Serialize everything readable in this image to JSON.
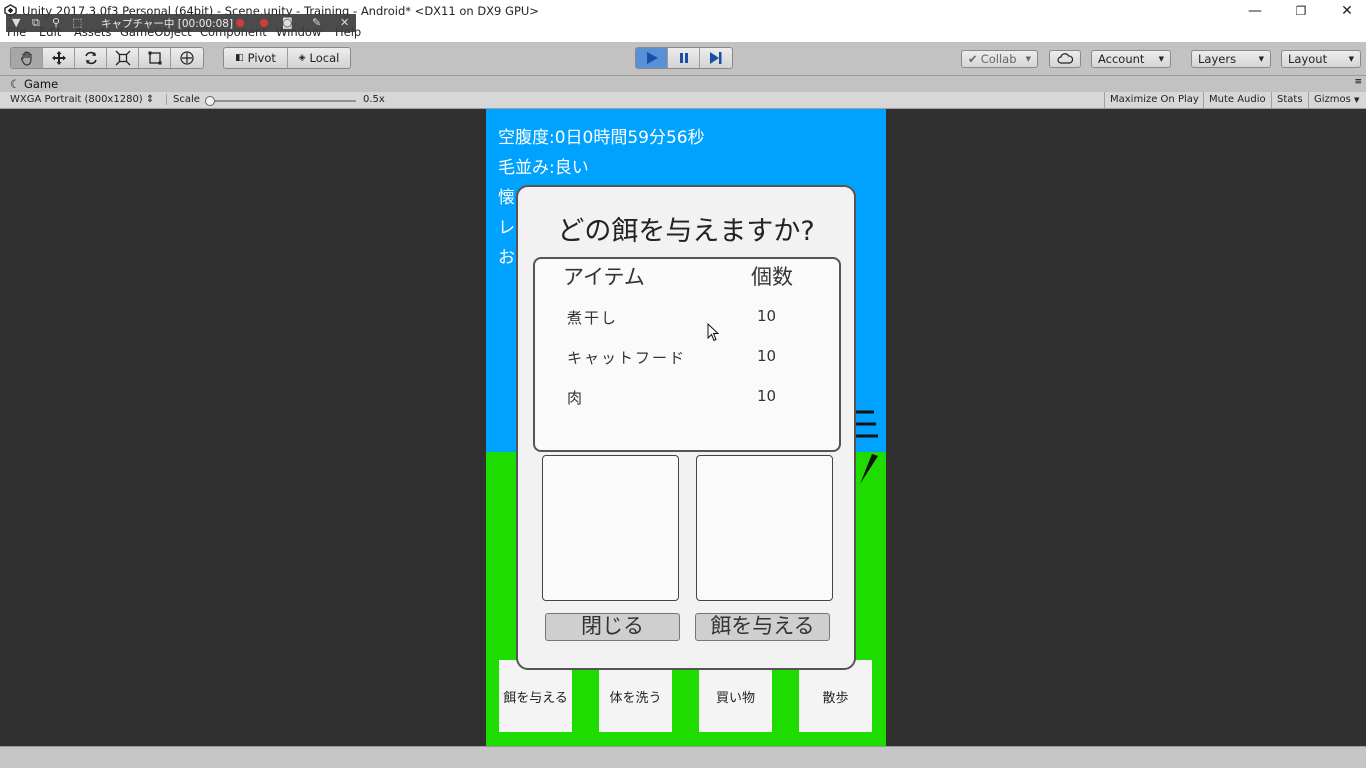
{
  "window": {
    "title": "Unity 2017.3.0f3 Personal (64bit) - Scene.unity - Training - Android* <DX11 on DX9 GPU>",
    "minimize": "—",
    "maximize": "❐",
    "close": "✕"
  },
  "menu": [
    "File",
    "Edit",
    "Assets",
    "GameObject",
    "Component",
    "Window",
    "Help"
  ],
  "capture_overlay": {
    "label": "キャプチャー中 [00:00:08]"
  },
  "toolbar": {
    "pivot": "Pivot",
    "local": "Local",
    "collab": "Collab",
    "account": "Account",
    "layers": "Layers",
    "layout": "Layout"
  },
  "game_tab": {
    "label": "Game",
    "resolution": "WXGA Portrait (800x1280)",
    "scale_label": "Scale",
    "scale_value": "0.5x",
    "maximize_on_play": "Maximize On Play",
    "mute_audio": "Mute Audio",
    "stats": "Stats",
    "gizmos": "Gizmos"
  },
  "game": {
    "status_lines": [
      "空腹度:0日0時間59分56秒",
      "毛並み:良い",
      "懐",
      "レ",
      "お"
    ],
    "dialog": {
      "title": "どの餌を与えますか?",
      "col_item": "アイテム",
      "col_count": "個数",
      "items": [
        {
          "name": "煮干し",
          "count": "10"
        },
        {
          "name": "キャットフード",
          "count": "10"
        },
        {
          "name": "肉",
          "count": "10"
        }
      ],
      "close_button": "閉じる",
      "feed_button": "餌を与える"
    },
    "actions": [
      "餌を与える",
      "体を洗う",
      "買い物",
      "散歩"
    ]
  },
  "colors": {
    "sky": "#00a2ff",
    "grass": "#1fdc00",
    "editor_gray": "#c2c2c2",
    "viewport_bg": "#303030",
    "play_active": "#5a91d6"
  }
}
